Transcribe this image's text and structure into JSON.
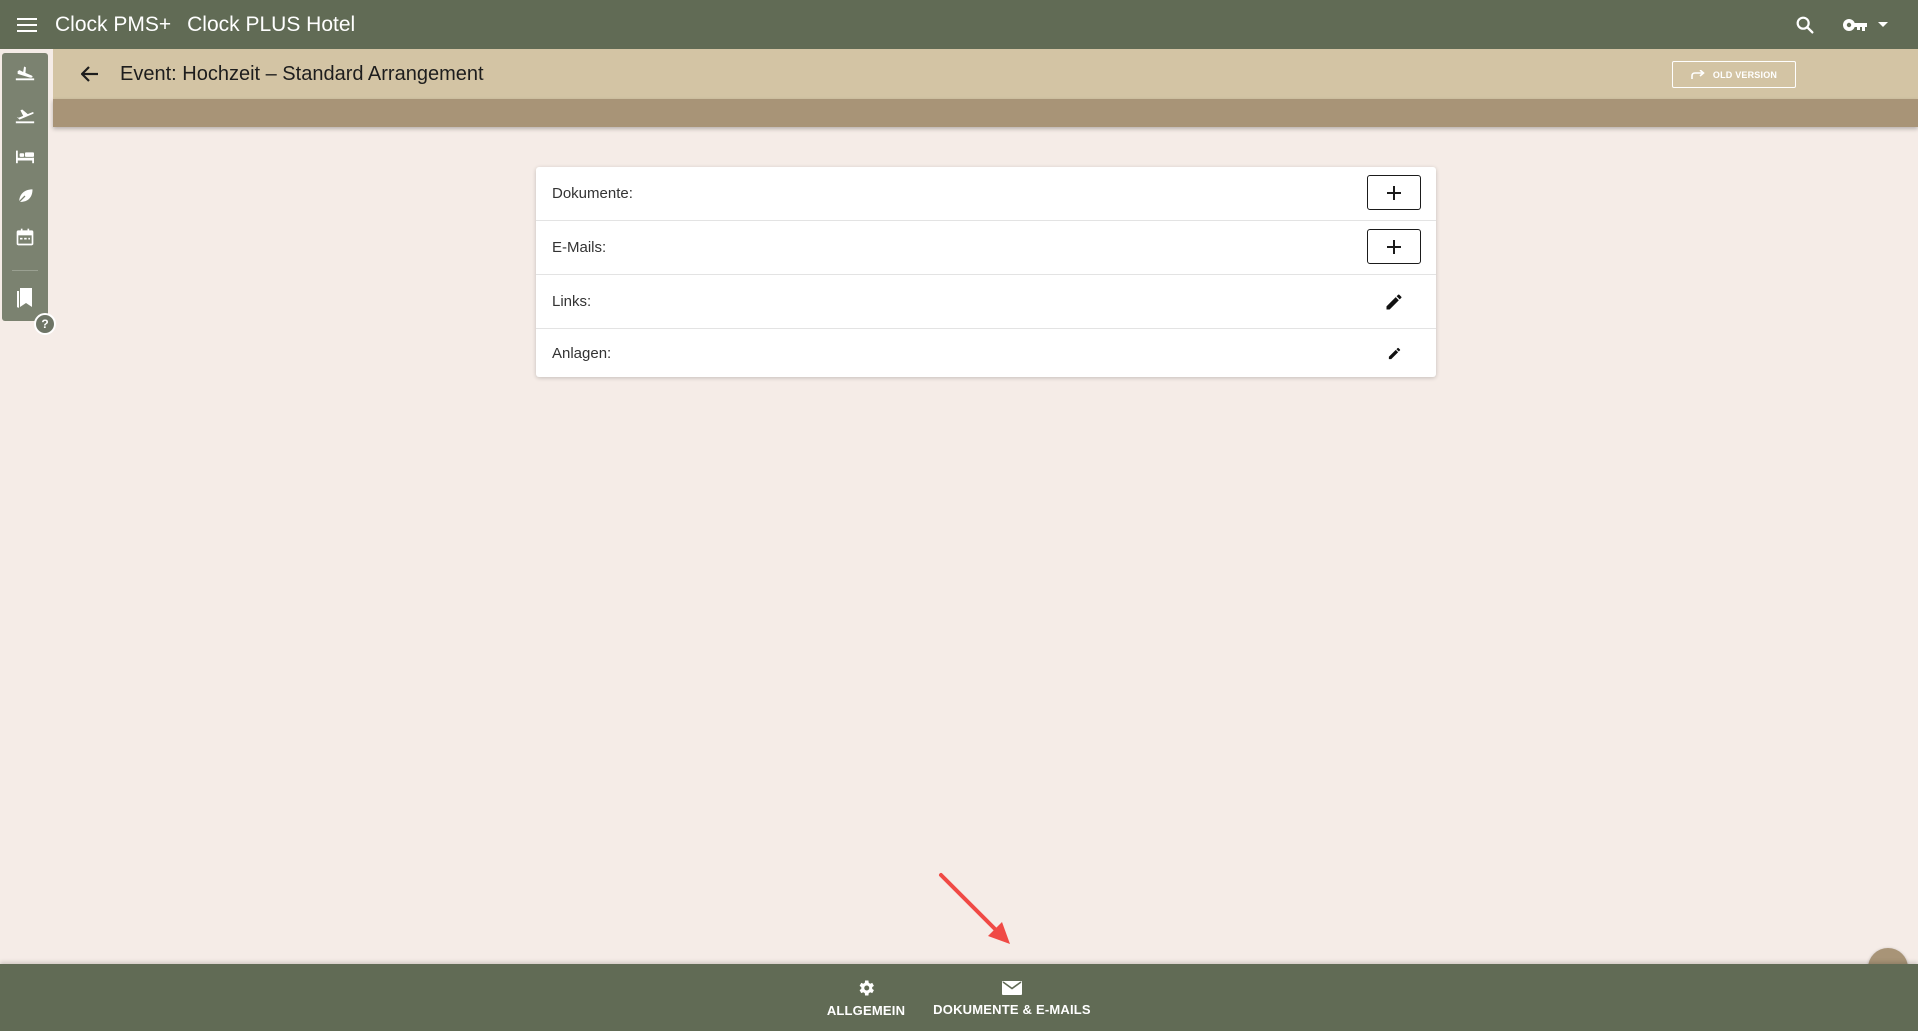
{
  "topbar": {
    "app_name": "Clock PMS+",
    "hotel_name": "Clock PLUS Hotel",
    "icons": [
      "menu-icon",
      "search-icon",
      "key-icon",
      "dropdown-arrow-icon"
    ]
  },
  "header": {
    "title": "Event: Hochzeit – Standard Arrangement",
    "old_version_label": "OLD VERSION"
  },
  "sidebar": {
    "items": [
      {
        "icon": "arrival-icon"
      },
      {
        "icon": "departure-icon"
      },
      {
        "icon": "bed-icon"
      },
      {
        "icon": "leaf-icon"
      },
      {
        "icon": "calendar-icon"
      },
      {
        "icon": "bookmarks-icon"
      }
    ],
    "help_label": "?"
  },
  "sections": [
    {
      "label": "Dokumente:",
      "action": "add"
    },
    {
      "label": "E-Mails:",
      "action": "add"
    },
    {
      "label": "Links:",
      "action": "edit"
    },
    {
      "label": "Anlagen:",
      "action": "edit"
    }
  ],
  "bottom_nav": {
    "general_label": "ALLGEMEIN",
    "documents_label": "DOKUMENTE & E-MAILS"
  },
  "colors": {
    "topbar": "#616b55",
    "subheader": "#d3c4a4",
    "tabstrip": "#a89477",
    "background": "#f5ece7",
    "annotation_arrow": "#f04a45"
  }
}
